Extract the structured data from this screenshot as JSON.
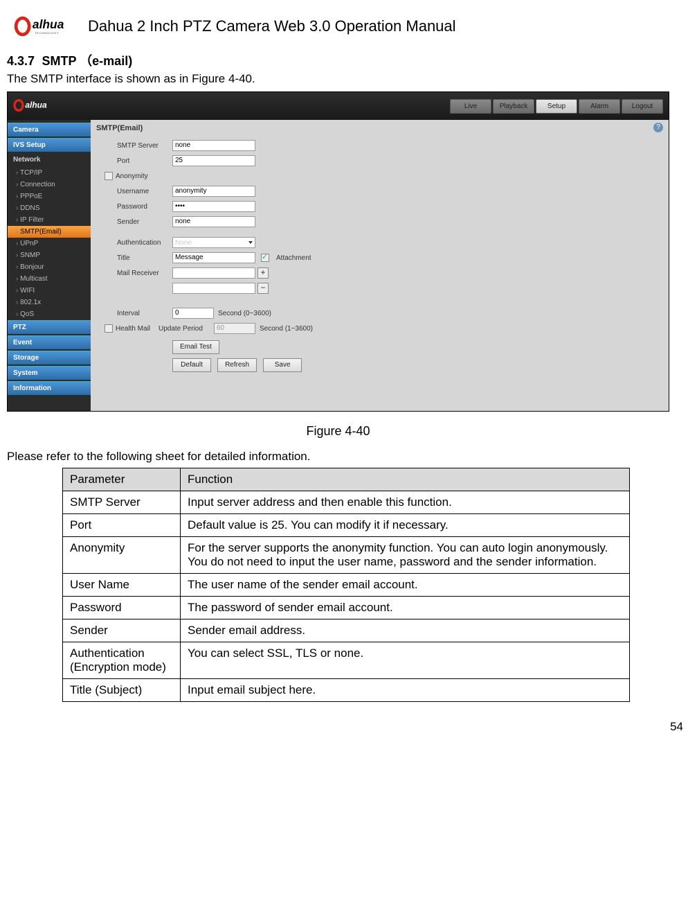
{
  "header": {
    "logo_text": "alhua",
    "logo_sub": "TECHNOLOGY",
    "doc_title": "Dahua 2 Inch PTZ Camera Web 3.0 Operation Manual"
  },
  "section": {
    "number": "4.3.7",
    "title": "SMTP （e-mail)",
    "intro": "The SMTP interface is shown as in Figure 4-40."
  },
  "screenshot": {
    "top_tabs": [
      "Live",
      "Playback",
      "Setup",
      "Alarm",
      "Logout"
    ],
    "top_active": "Setup",
    "sidebar": {
      "groups_top": [
        "Camera",
        "IVS Setup",
        "Network"
      ],
      "network_subs": [
        "TCP/IP",
        "Connection",
        "PPPoE",
        "DDNS",
        "IP Filter",
        "SMTP(Email)",
        "UPnP",
        "SNMP",
        "Bonjour",
        "Multicast",
        "WIFI",
        "802.1x",
        "QoS"
      ],
      "active_sub": "SMTP(Email)",
      "groups_bottom": [
        "PTZ",
        "Event",
        "Storage",
        "System",
        "Information"
      ]
    },
    "content": {
      "title": "SMTP(Email)",
      "help": "?",
      "fields": {
        "smtp_server_label": "SMTP Server",
        "smtp_server_value": "none",
        "port_label": "Port",
        "port_value": "25",
        "anonymity_label": "Anonymity",
        "username_label": "Username",
        "username_value": "anonymity",
        "password_label": "Password",
        "password_value": "••••",
        "sender_label": "Sender",
        "sender_value": "none",
        "auth_label": "Authentication",
        "auth_value": "None",
        "title_label": "Title",
        "title_value": "Message",
        "attach_label": "Attachment",
        "mailrecv_label": "Mail Receiver",
        "interval_label": "Interval",
        "interval_value": "0",
        "interval_after": "Second (0~3600)",
        "health_label": "Health Mail",
        "update_label": "Update Period",
        "update_value": "60",
        "update_after": "Second (1~3600)",
        "btn_emailtest": "Email Test",
        "btn_default": "Default",
        "btn_refresh": "Refresh",
        "btn_save": "Save"
      }
    }
  },
  "figure_caption": "Figure 4-40",
  "table_intro": "Please refer to the following sheet for detailed information.",
  "table": {
    "headers": [
      "Parameter",
      "Function"
    ],
    "rows": [
      [
        "SMTP Server",
        "Input server address and then enable this function."
      ],
      [
        "Port",
        "Default value is 25. You can modify it if necessary."
      ],
      [
        "Anonymity",
        "For the server supports the anonymity function. You can auto login anonymously. You do not need to input the user name, password and the sender information."
      ],
      [
        "User Name",
        "The user name of the sender email account."
      ],
      [
        "Password",
        "The password of sender email account."
      ],
      [
        "Sender",
        "Sender email address."
      ],
      [
        "Authentication (Encryption mode)",
        "You can select SSL, TLS or none."
      ],
      [
        "Title (Subject)",
        "Input email subject here."
      ]
    ]
  },
  "page_number": "54"
}
